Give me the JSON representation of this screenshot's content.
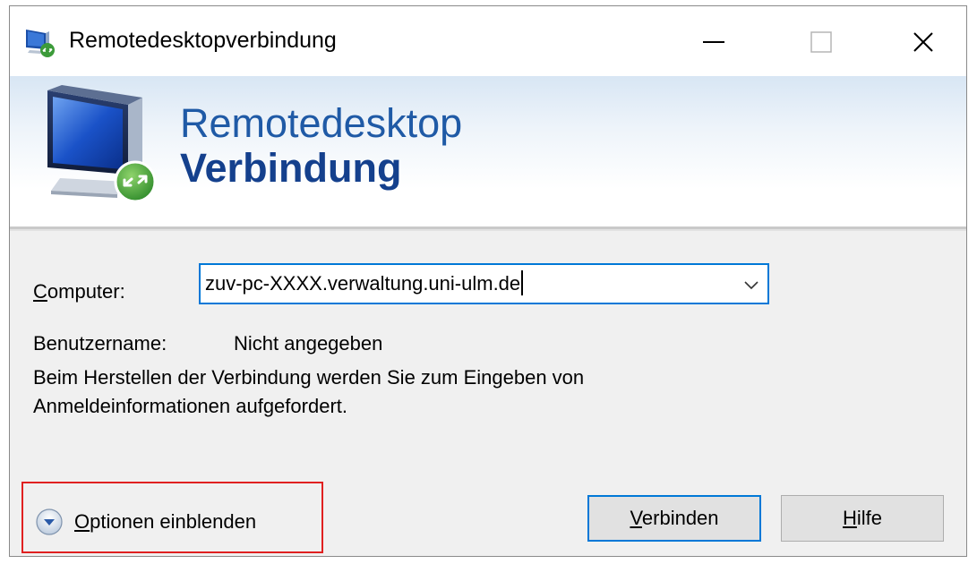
{
  "window": {
    "title": "Remotedesktopverbindung",
    "controls": {
      "minimize": "minimize",
      "maximize": "maximize",
      "close": "close"
    }
  },
  "banner": {
    "line1": "Remotedesktop",
    "line2": "Verbindung"
  },
  "form": {
    "computer_label": "Computer:",
    "computer_value": "zuv-pc-XXXX.verwaltung.uni-ulm.de",
    "username_label": "Benutzername:",
    "username_value": "Nicht angegeben",
    "info_line1": "Beim Herstellen der Verbindung werden Sie zum Eingeben von",
    "info_line2": "Anmeldeinformationen aufgefordert."
  },
  "footer": {
    "options_label": "Optionen einblenden",
    "connect_label": "Verbinden",
    "help_label": "Hilfe"
  },
  "colors": {
    "accent": "#0078d7",
    "banner_title": "#1f5aa6",
    "highlight_box": "#e02020"
  },
  "icons": [
    "rdp-app-icon",
    "minimize-icon",
    "maximize-icon",
    "close-icon",
    "monitor-connection-icon",
    "chevron-down-icon",
    "expand-options-icon"
  ]
}
